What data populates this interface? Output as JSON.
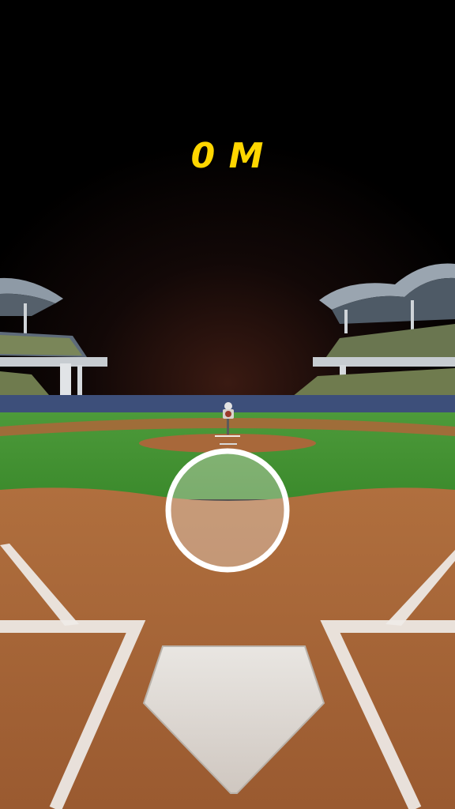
{
  "hud": {
    "distance_value": "0",
    "distance_unit": "M",
    "distance_color": "#ffd600"
  },
  "aim_reticle": {
    "icon": "aim-circle-icon"
  },
  "colors": {
    "sky": "#000000",
    "grass": "#3f8f2f",
    "dirt": "#a8683a",
    "chalk": "#f2f2f2",
    "outfield_wall": "#3d4f7a"
  }
}
